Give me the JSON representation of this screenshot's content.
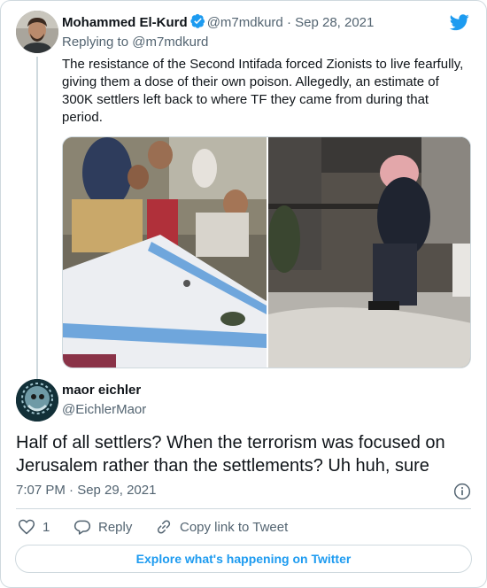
{
  "parent_tweet": {
    "author_name": "Mohammed El-Kurd",
    "author_handle": "@m7mdkurd",
    "separator": "·",
    "date": "Sep 28, 2021",
    "replying_to_prefix": "Replying to",
    "replying_to_handle": "@m7mdkurd",
    "text": "The resistance of the Second Intifada forced Zionists to live fearfully, giving them a dose of their own poison. Allegedly, an estimate of 300K settlers left back to where TF they came from during that period.",
    "media_count": 2
  },
  "reply_tweet": {
    "author_name": "maor eichler",
    "author_handle": "@EichlerMaor",
    "text": "Half of all settlers? When the terrorism was focused on Jerusalem rather than the settlements? Uh huh, sure",
    "timestamp": "7:07 PM · Sep 29, 2021"
  },
  "actions": {
    "like_count": "1",
    "reply_label": "Reply",
    "copy_link_label": "Copy link to Tweet"
  },
  "footer": {
    "explore_label": "Explore what's happening on Twitter"
  },
  "icons": {
    "logo": "twitter-bird-icon",
    "verified": "verified-badge-icon",
    "info": "info-icon",
    "like": "heart-icon",
    "reply": "reply-bubble-icon",
    "link": "link-icon"
  },
  "colors": {
    "accent": "#1d9bf0",
    "text": "#0f1419",
    "secondary": "#536471",
    "border": "#cfd9de"
  }
}
